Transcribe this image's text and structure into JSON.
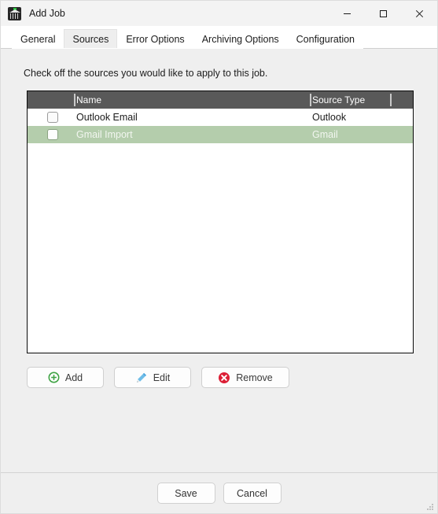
{
  "window": {
    "title": "Add Job",
    "icon": "archiver-app-icon",
    "controls": {
      "minimize": "minimize-icon",
      "maximize": "maximize-icon",
      "close": "close-icon"
    }
  },
  "tabs": [
    {
      "label": "General",
      "selected": false
    },
    {
      "label": "Sources",
      "selected": true
    },
    {
      "label": "Error Options",
      "selected": false
    },
    {
      "label": "Archiving Options",
      "selected": false
    },
    {
      "label": "Configuration",
      "selected": false
    }
  ],
  "main": {
    "instruction": "Check off the sources you would like to apply to this job.",
    "grid": {
      "columns": [
        {
          "key": "check",
          "header": ""
        },
        {
          "key": "name",
          "header": "Name"
        },
        {
          "key": "source_type",
          "header": "Source Type"
        }
      ],
      "rows": [
        {
          "checked": false,
          "name": "Outlook Email",
          "source_type": "Outlook",
          "selected": false
        },
        {
          "checked": false,
          "name": "Gmail Import",
          "source_type": "Gmail",
          "selected": true
        }
      ]
    },
    "actions": [
      {
        "label": "Add",
        "icon": "circle-plus-icon",
        "color": "#3fa344"
      },
      {
        "label": "Edit",
        "icon": "pencil-icon",
        "color": "#4ba3dd"
      },
      {
        "label": "Remove",
        "icon": "circle-x-icon",
        "color": "#dc1f36"
      }
    ]
  },
  "footer": {
    "save_label": "Save",
    "cancel_label": "Cancel"
  },
  "colors": {
    "window_bg": "#efefef",
    "titlebar_bg": "#f3f3f3",
    "tabstrip_bg": "#ffffff",
    "tab_selected_bg": "#eeeeee",
    "grid_header_bg": "#595959",
    "grid_header_text": "#ffffff",
    "row_selected_bg": "#b4cdac",
    "row_selected_text": "#f2f6f0",
    "panel_border": "#0a0a0a",
    "accent_add": "#3fa344",
    "accent_edit": "#4ba3dd",
    "accent_remove": "#dc1f36"
  }
}
